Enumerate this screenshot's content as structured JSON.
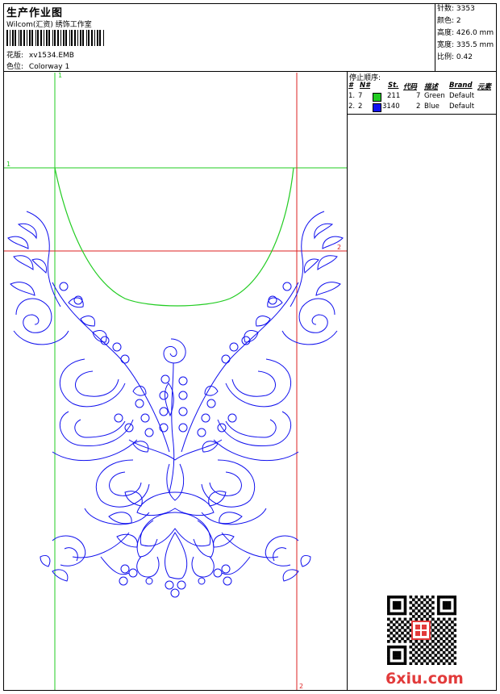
{
  "header": {
    "title": "生产作业图",
    "company": "Wilcom(汇资) 绣饰工作室",
    "design_label": "花版:",
    "design_value": "xv1534.EMB",
    "colorway_label": "色位:",
    "colorway_value": "Colorway 1"
  },
  "stats": [
    {
      "label": "针数:",
      "value": "3353"
    },
    {
      "label": "颜色:",
      "value": "2"
    },
    {
      "label": "高度:",
      "value": "426.0 mm"
    },
    {
      "label": "宽度:",
      "value": "335.5 mm"
    },
    {
      "label": "比例:",
      "value": "0.42"
    }
  ],
  "stop_sequence": {
    "title": "停止顺序:",
    "columns": [
      "#",
      "N#",
      "St.",
      "代码",
      "描述",
      "Brand",
      "元素"
    ],
    "rows": [
      {
        "index": "1.",
        "needle": "7",
        "color": "#22cc22",
        "stitches": "211",
        "code": "7",
        "desc": "Green",
        "brand": "Default"
      },
      {
        "index": "2.",
        "needle": "2",
        "color": "#1010ee",
        "stitches": "3140",
        "code": "2",
        "desc": "Blue",
        "brand": "Default"
      }
    ]
  },
  "guides": {
    "green_label_top": "1",
    "green_label_left": "1",
    "red_label_right": "2",
    "red_label_bottom": "2"
  },
  "colors": {
    "frame": "#000000",
    "guide_green": "#22cc22",
    "guide_red": "#dd2222",
    "embroidery_blue": "#1010ee",
    "embroidery_green": "#22cc22",
    "watermark": "#e23b3b"
  },
  "watermark": {
    "text": "6xiu.com",
    "qr_icon": "qr-code-icon",
    "seal_icon": "red-seal-icon"
  }
}
